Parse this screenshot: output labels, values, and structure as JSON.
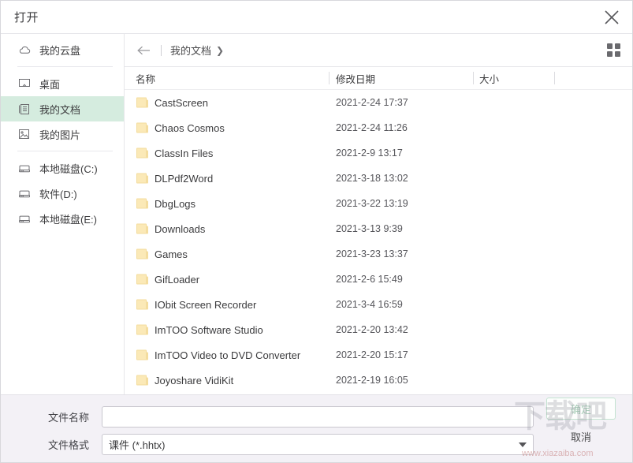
{
  "window": {
    "title": "打开",
    "close_icon": "close-icon"
  },
  "sidebar": {
    "items": [
      {
        "label": "我的云盘",
        "icon": "cloud-icon",
        "selected": false,
        "separator_after": true
      },
      {
        "label": "桌面",
        "icon": "desktop-icon",
        "selected": false,
        "separator_after": false
      },
      {
        "label": "我的文档",
        "icon": "documents-icon",
        "selected": true,
        "separator_after": false
      },
      {
        "label": "我的图片",
        "icon": "pictures-icon",
        "selected": false,
        "separator_after": true
      },
      {
        "label": "本地磁盘(C:)",
        "icon": "drive-icon",
        "selected": false,
        "separator_after": false
      },
      {
        "label": "软件(D:)",
        "icon": "drive-icon",
        "selected": false,
        "separator_after": false
      },
      {
        "label": "本地磁盘(E:)",
        "icon": "drive-icon",
        "selected": false,
        "separator_after": false
      }
    ]
  },
  "toolbar": {
    "back_icon": "back-arrow-icon",
    "breadcrumb": "我的文档",
    "breadcrumb_chevron": "❯",
    "view_toggle_icon": "grid-view-icon"
  },
  "filelist": {
    "columns": [
      "名称",
      "修改日期",
      "大小"
    ],
    "rows": [
      {
        "name": "CastScreen",
        "date": "2021-2-24 17:37",
        "size": ""
      },
      {
        "name": "Chaos Cosmos",
        "date": "2021-2-24 11:26",
        "size": ""
      },
      {
        "name": "ClassIn Files",
        "date": "2021-2-9 13:17",
        "size": ""
      },
      {
        "name": "DLPdf2Word",
        "date": "2021-3-18 13:02",
        "size": ""
      },
      {
        "name": "DbgLogs",
        "date": "2021-3-22 13:19",
        "size": ""
      },
      {
        "name": "Downloads",
        "date": "2021-3-13 9:39",
        "size": ""
      },
      {
        "name": "Games",
        "date": "2021-3-23 13:37",
        "size": ""
      },
      {
        "name": "GifLoader",
        "date": "2021-2-6 15:49",
        "size": ""
      },
      {
        "name": "IObit Screen Recorder",
        "date": "2021-3-4 16:59",
        "size": ""
      },
      {
        "name": "ImTOO Software Studio",
        "date": "2021-2-20 13:42",
        "size": ""
      },
      {
        "name": "ImTOO Video to DVD Converter",
        "date": "2021-2-20 15:17",
        "size": ""
      },
      {
        "name": "Joyoshare VidiKit",
        "date": "2021-2-19 16:05",
        "size": ""
      }
    ]
  },
  "bottom": {
    "filename_label": "文件名称",
    "filename_value": "",
    "filename_placeholder": "",
    "format_label": "文件格式",
    "format_value": "课件 (*.hhtx)",
    "ok_label": "确定",
    "cancel_label": "取消"
  },
  "watermark": {
    "text": "下载吧",
    "url": "www.xiazaiba.com"
  },
  "colors": {
    "accent_selected": "#d5ecdf",
    "folder": "#fbe9b7",
    "panel": "#f3f1f6"
  }
}
